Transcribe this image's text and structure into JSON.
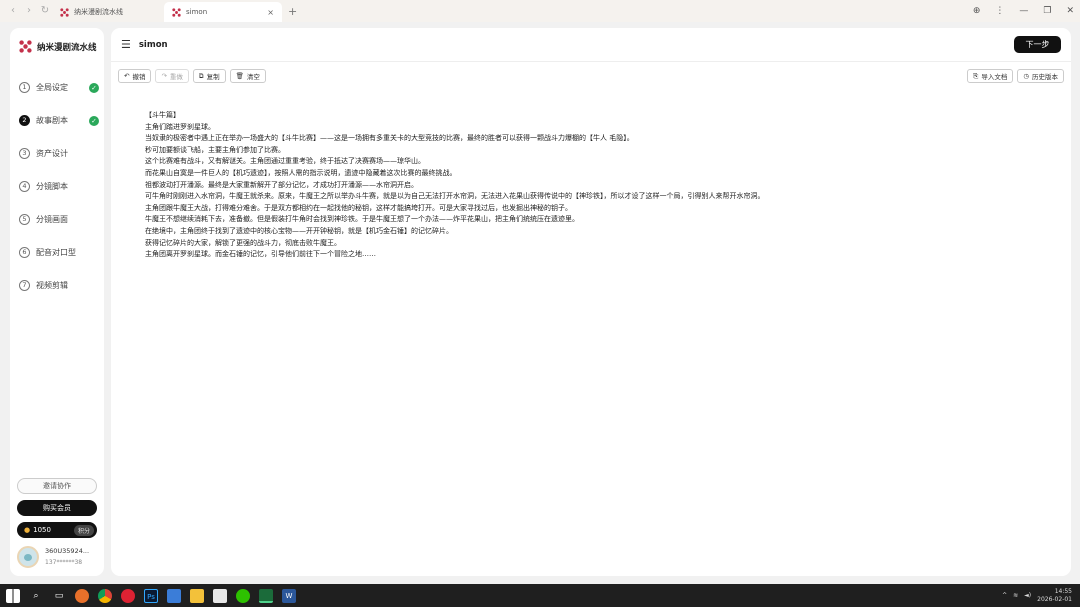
{
  "browser": {
    "nav": {
      "back": "‹",
      "forward": "›",
      "reload": "↻"
    },
    "tabs": [
      {
        "title": "纳米漫剧流水线",
        "close": ""
      },
      {
        "title": "simon",
        "close": "×"
      }
    ],
    "new_tab": "+",
    "controls": {
      "globe": "⊕",
      "more": "⋮",
      "minimize": "—",
      "restore": "❐",
      "close": "✕"
    }
  },
  "sidebar": {
    "brand": "纳米漫剧流水线",
    "steps": [
      {
        "num": "1",
        "label": "全局设定",
        "done": true
      },
      {
        "num": "2",
        "label": "故事剧本",
        "done": true,
        "active": true
      },
      {
        "num": "3",
        "label": "资产设计",
        "done": false
      },
      {
        "num": "4",
        "label": "分镜脚本",
        "done": false
      },
      {
        "num": "5",
        "label": "分镜画面",
        "done": false
      },
      {
        "num": "6",
        "label": "配音对口型",
        "done": false
      },
      {
        "num": "7",
        "label": "视频剪辑",
        "done": false
      }
    ],
    "check_mark": "✓",
    "collab_label": "邀请协作",
    "buy_label": "购买会员",
    "credits_value": "1050",
    "credits_tag": "积分",
    "coin_icon": "●",
    "user_name": "360U35924...",
    "user_sub": "137******38"
  },
  "main": {
    "title": "simon",
    "menu_icon": "☰",
    "next_label": "下一步",
    "toolbar": {
      "undo": "撤销",
      "redo": "重做",
      "copy": "复制",
      "clear": "清空",
      "import": "导入文档",
      "history": "历史版本"
    },
    "story_lines": [
      "【斗牛篇】",
      "主角们踏进罗刹星球。",
      "当奴隶的极密者中遇上正在举办一场盛大的【斗牛比赛】——这是一场拥有多重关卡的大型竞技的比赛，最终的胜者可以获得一颗战斗力爆棚的【牛人 毛隐】。",
      "秒可加要额谈飞船，主要主角们参加了比赛。",
      "这个比赛难有战斗，又有解谜关。主角团通过重重考验，终于抵达了决赛赛场——琼华山。",
      "而花果山自寞是一件巨人的【机巧遗迹】，按照人需的指示说明，遗迹中隐藏着这次比赛的最终挑战。",
      "祖都波动打开潘源。最终是大家重新解开了部分记忆，才成功打开潘源——水帘洞开启。",
      "可牛角时刚刚进入水帘洞，牛魔王就杀来。原来，牛魔王之所以举办斗牛赛，就是以为自己无法打开水帘洞，无法进入花果山获得传说中的【神珍铁】，所以才设了这样一个局，引得别人来帮开水帘洞。",
      "主角团跟牛魔王大战，打得难分难舍。于是双方都相约在一起找他的秘钥，这样才能搞垮打开。可是大家寻找过后，也发掘出神秘的钥子。",
      "牛魔王不想继续消耗下去，准备撤。但是假装打牛角时会找到神珍铁。于是牛魔王想了一个办法——炸平花果山，把主角们统统压在遗迹里。",
      "在绝境中，主角团终于找到了遗迹中的核心宝物——开开钟秘钥，就是【机巧金石锤】的记忆碎片。",
      "获得记忆碎片的大家，解锁了更强的战斗力，彻底击败牛魔王。",
      "主角团离开罗刹星球。而金石锤的记忆，引导他们前往下一个冒险之地……"
    ]
  },
  "taskbar": {
    "icons": [
      "windows-icon",
      "search-icon",
      "task-view-icon",
      "firefox-icon",
      "chrome-icon",
      "app-red-icon",
      "photoshop-icon",
      "app-blue-icon",
      "file-explorer-icon",
      "notepad-icon",
      "wechat-icon",
      "terminal-icon",
      "word-icon"
    ],
    "time": "14:55",
    "date": "2026-02-01",
    "tray_arrow": "^",
    "tray_wifi": "≋",
    "tray_sound": "◄)"
  },
  "colors": {
    "accent": "#111111",
    "success": "#2aa85a",
    "brand_red": "#c4314b"
  }
}
